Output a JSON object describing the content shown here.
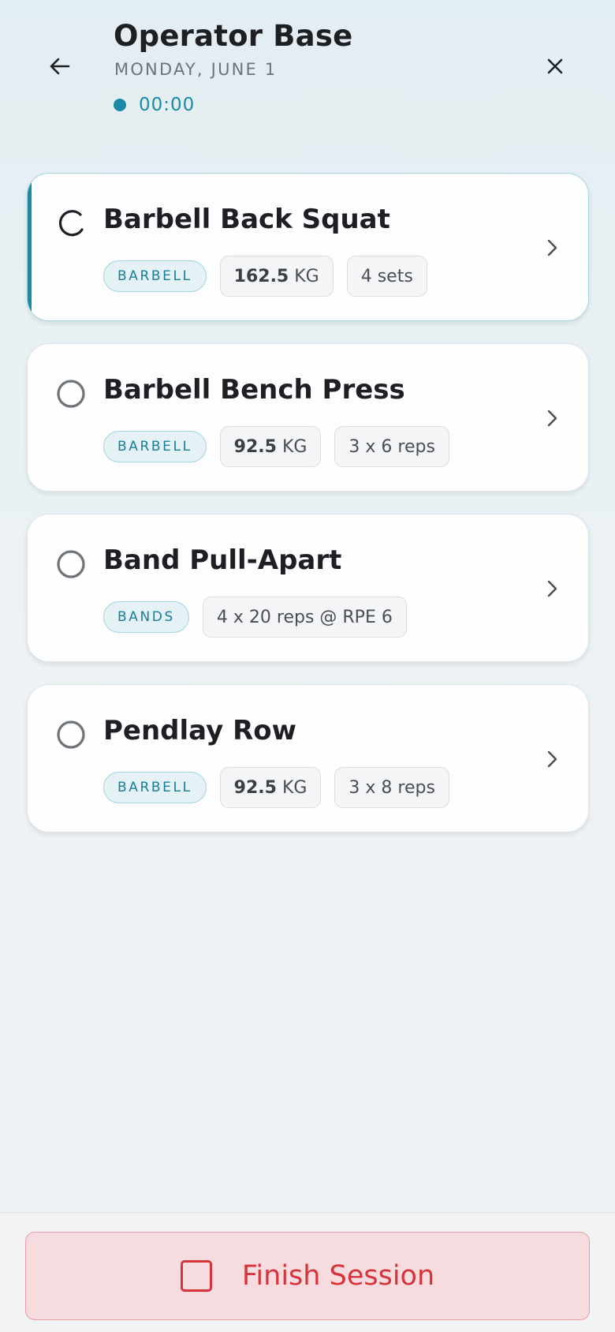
{
  "header": {
    "title": "Operator Base",
    "date": "MONDAY, JUNE 1",
    "timer": "00:00",
    "back_icon": "arrow-left-icon",
    "close_icon": "close-icon"
  },
  "exercises": [
    {
      "name": "Barbell Back Squat",
      "equipment": "BARBELL",
      "weight_value": "162.5",
      "weight_unit": "KG",
      "scheme": "4 sets",
      "status": "in-progress"
    },
    {
      "name": "Barbell Bench Press",
      "equipment": "BARBELL",
      "weight_value": "92.5",
      "weight_unit": "KG",
      "scheme": "3 x 6 reps",
      "status": "not-started"
    },
    {
      "name": "Band Pull-Apart",
      "equipment": "BANDS",
      "scheme": "4 x 20 reps @ RPE 6",
      "status": "not-started"
    },
    {
      "name": "Pendlay Row",
      "equipment": "BARBELL",
      "weight_value": "92.5",
      "weight_unit": "KG",
      "scheme": "3 x 8 reps",
      "status": "not-started"
    }
  ],
  "footer": {
    "finish_label": "Finish Session"
  },
  "colors": {
    "accent": "#1a8aa6",
    "danger": "#d6333b",
    "danger_bg": "#f6dcdf"
  }
}
